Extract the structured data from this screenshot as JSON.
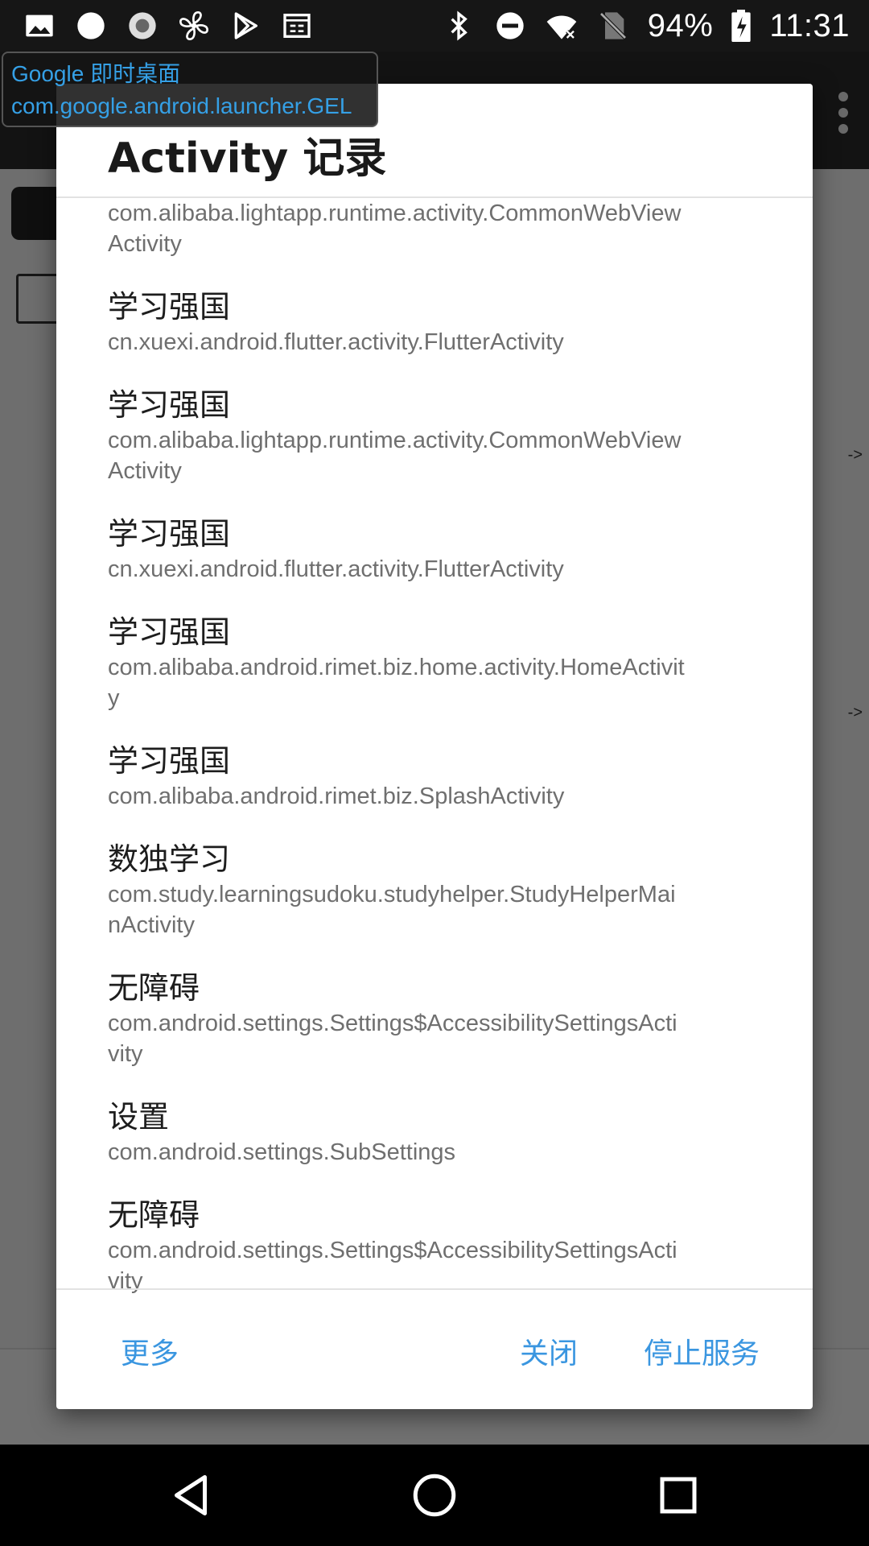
{
  "status_bar": {
    "battery": "94%",
    "time": "11:31",
    "left_icons": [
      "gallery-icon",
      "circle-icon",
      "record-icon",
      "fan-icon",
      "play-store-icon",
      "news-icon"
    ],
    "right_icons": [
      "bluetooth-icon",
      "do-not-disturb-icon",
      "wifi-icon",
      "no-sim-icon",
      "battery-icon"
    ]
  },
  "toast": {
    "line1": "Google 即时桌面",
    "line2": "com.google.android.launcher.GEL"
  },
  "dialog": {
    "title": "Activity 记录",
    "entries": [
      {
        "name": "",
        "activity": "com.alibaba.lightapp.runtime.activity.CommonWebViewActivity"
      },
      {
        "name": "学习强国",
        "activity": "cn.xuexi.android.flutter.activity.FlutterActivity"
      },
      {
        "name": "学习强国",
        "activity": "com.alibaba.lightapp.runtime.activity.CommonWebViewActivity"
      },
      {
        "name": "学习强国",
        "activity": "cn.xuexi.android.flutter.activity.FlutterActivity"
      },
      {
        "name": "学习强国",
        "activity": "com.alibaba.android.rimet.biz.home.activity.HomeActivity"
      },
      {
        "name": "学习强国",
        "activity": "com.alibaba.android.rimet.biz.SplashActivity"
      },
      {
        "name": "数独学习",
        "activity": "com.study.learningsudoku.studyhelper.StudyHelperMainActivity"
      },
      {
        "name": "无障碍",
        "activity": "com.android.settings.Settings$AccessibilitySettingsActivity"
      },
      {
        "name": "设置",
        "activity": "com.android.settings.SubSettings"
      },
      {
        "name": "无障碍",
        "activity": "com.android.settings.Settings$AccessibilitySettingsActivity"
      }
    ],
    "buttons": {
      "more": "更多",
      "close": "关闭",
      "stop_service": "停止服务"
    }
  },
  "background": {
    "arrow_label": "->"
  },
  "colors": {
    "accent": "#3a96e0",
    "toast_text": "#35a0e6"
  }
}
